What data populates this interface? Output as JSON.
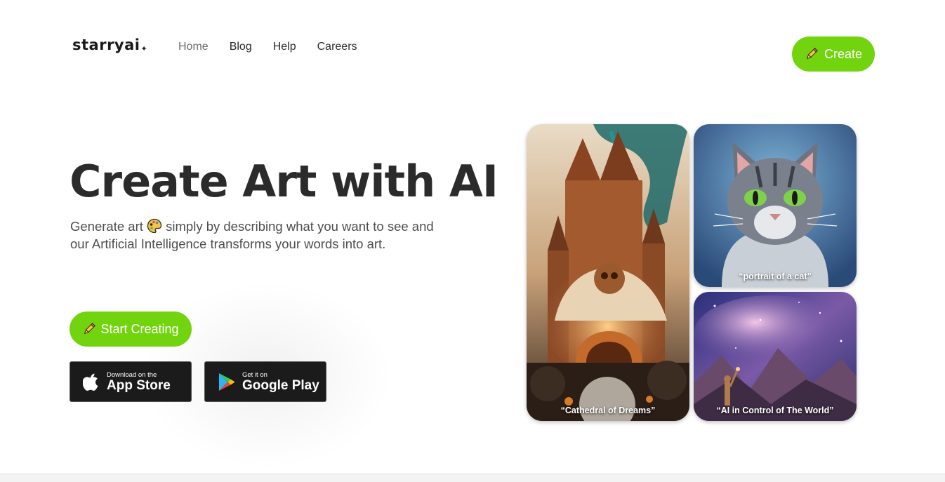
{
  "nav": {
    "logo": "starryai",
    "links": [
      {
        "label": "Home",
        "active": true
      },
      {
        "label": "Blog",
        "active": false
      },
      {
        "label": "Help",
        "active": false
      },
      {
        "label": "Careers",
        "active": false
      }
    ],
    "create_label": "Create"
  },
  "hero": {
    "title": "Create Art with AI",
    "subtitle_part1": "Generate art",
    "subtitle_part2": "simply by describing what you want to see and our Artificial Intelligence transforms your words into art.",
    "start_label": "Start Creating"
  },
  "stores": {
    "apple_small": "Download on the",
    "apple_big": "App Store",
    "google_small": "Get it on",
    "google_big": "Google Play"
  },
  "gallery": {
    "cathedral_caption": "“Cathedral of Dreams”",
    "cat_caption": "“portrait of a cat”",
    "space_caption": "“AI in Control of The World”"
  },
  "colors": {
    "accent": "#72d40e",
    "store_bg": "#1b1b1b",
    "title": "#2b2b2b"
  },
  "icons": [
    "pencil-icon",
    "palette-emoji-icon",
    "apple-icon",
    "google-play-icon",
    "sparkle-icon"
  ]
}
